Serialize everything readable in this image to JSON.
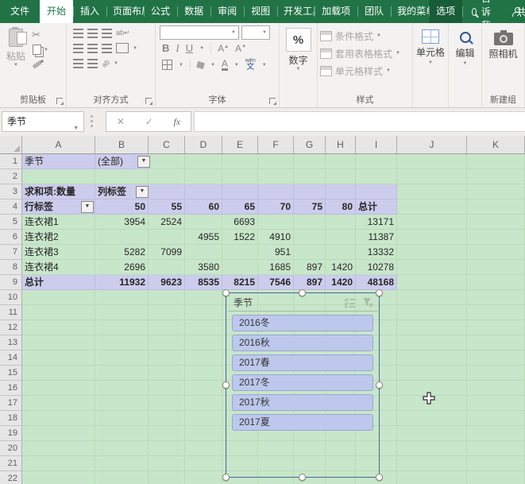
{
  "tabbar": {
    "tabs": [
      {
        "label": "文件",
        "state": "file"
      },
      {
        "label": "开始",
        "state": "active"
      },
      {
        "label": "插入"
      },
      {
        "label": "页面布局"
      },
      {
        "label": "公式"
      },
      {
        "label": "数据"
      },
      {
        "label": "审阅"
      },
      {
        "label": "视图"
      },
      {
        "label": "开发工具"
      },
      {
        "label": "加载项"
      },
      {
        "label": "团队"
      },
      {
        "label": "我的菜单"
      },
      {
        "label": "选项",
        "state": "highlight"
      }
    ],
    "tell_me": "告诉我",
    "share": "共"
  },
  "ribbon": {
    "clipboard": {
      "label": "剪贴板",
      "paste": "粘贴"
    },
    "alignment": {
      "label": "对齐方式",
      "wrap": "ab",
      "orient": "ab"
    },
    "font": {
      "label": "字体",
      "bold": "B",
      "italic": "I",
      "underline": "U",
      "grow": "A",
      "shrink": "A",
      "color": "A",
      "phonetic_pinyin": "wén",
      "phonetic_char": "文"
    },
    "number": {
      "label": "数字",
      "percent": "%"
    },
    "styles": {
      "label": "样式",
      "items": [
        "条件格式",
        "套用表格格式",
        "单元格样式"
      ]
    },
    "cells": {
      "label": "单元格"
    },
    "editing": {
      "label": "编辑"
    },
    "camera": {
      "label": "照相机"
    },
    "new_group": {
      "label": "新建组"
    }
  },
  "formula_bar": {
    "name_box": "季节",
    "cancel": "✕",
    "enter": "✓",
    "function": "fx",
    "value": ""
  },
  "sheet": {
    "col_headers": [
      "A",
      "B",
      "C",
      "D",
      "E",
      "F",
      "G",
      "H",
      "I",
      "J",
      "K"
    ],
    "visible_rows": 22,
    "pivot": {
      "filter": {
        "label": "季节",
        "value": "(全部)"
      },
      "value_field": "求和项:数量",
      "col_label": "列标签",
      "row_label": "行标签",
      "columns": [
        "50",
        "55",
        "60",
        "65",
        "70",
        "75",
        "80",
        "总计"
      ],
      "data_rows": [
        {
          "label": "连衣裙1",
          "values": [
            "3954",
            "2524",
            "",
            "6693",
            "",
            "",
            "",
            "13171"
          ]
        },
        {
          "label": "连衣裙2",
          "values": [
            "",
            "",
            "4955",
            "1522",
            "4910",
            "",
            "",
            "11387"
          ]
        },
        {
          "label": "连衣裙3",
          "values": [
            "5282",
            "7099",
            "",
            "",
            "951",
            "",
            "",
            "13332"
          ]
        },
        {
          "label": "连衣裙4",
          "values": [
            "2696",
            "",
            "3580",
            "",
            "1685",
            "897",
            "1420",
            "10278"
          ]
        }
      ],
      "grand_total": {
        "label": "总计",
        "values": [
          "11932",
          "9623",
          "8535",
          "8215",
          "7546",
          "897",
          "1420",
          "48168"
        ]
      }
    }
  },
  "slicer": {
    "title": "季节",
    "items": [
      "2016冬",
      "2016秋",
      "2017春",
      "2017冬",
      "2017秋",
      "2017夏"
    ]
  },
  "colors": {
    "excel_green": "#217346",
    "highlight_tab_green": "#185c38",
    "sheet_fill": "#c8e6c9",
    "pivot_header_fill": "#ccccec",
    "slicer_item_fill": "#bdc8ec",
    "slicer_border": "#44699e"
  }
}
